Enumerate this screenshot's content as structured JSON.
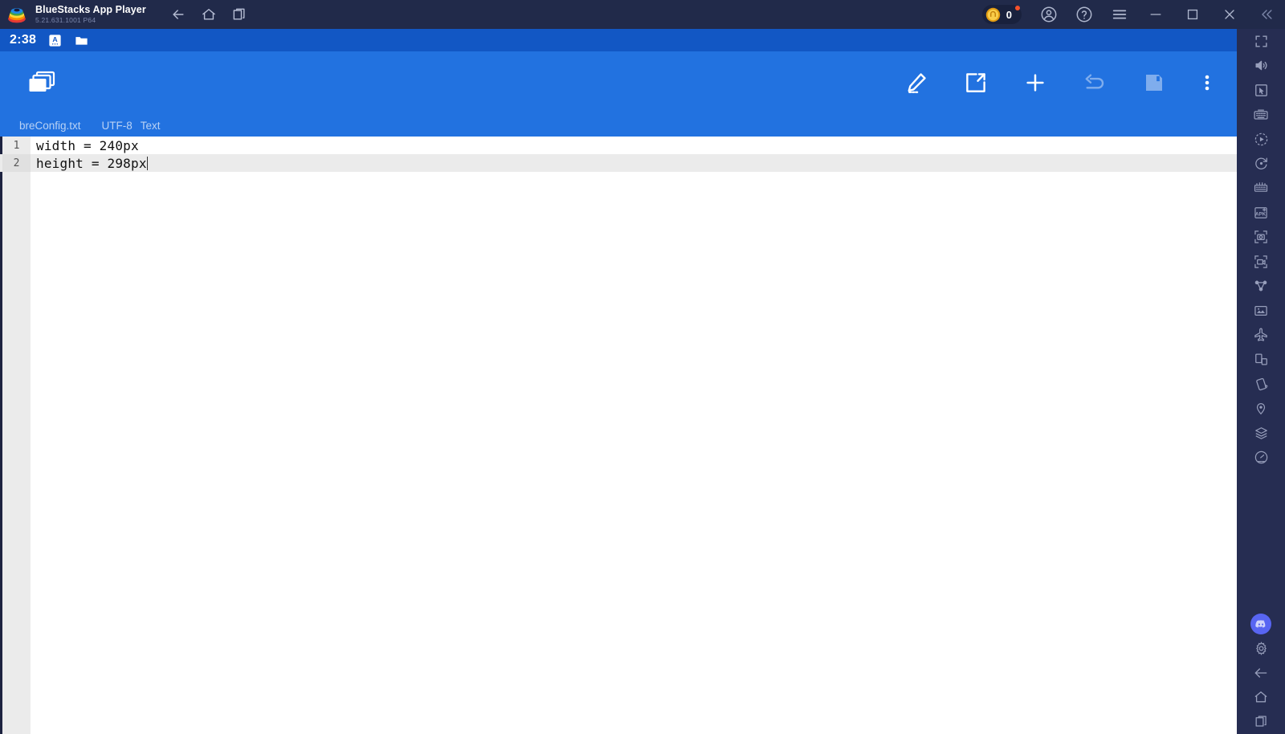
{
  "window": {
    "app_title": "BlueStacks App Player",
    "app_version": "5.21.631.1001 P64",
    "logo_icon": "bluestacks-logo-icon",
    "nav": [
      {
        "name": "back",
        "label": "Back",
        "icon": "arrow-left-icon"
      },
      {
        "name": "home",
        "label": "Home",
        "icon": "home-icon"
      },
      {
        "name": "recents",
        "label": "Recent apps",
        "icon": "recent-apps-icon"
      }
    ],
    "coin_badge": {
      "value": "0",
      "icon": "coin-icon",
      "has_notification_dot": true
    },
    "right_controls": [
      {
        "name": "account",
        "label": "Account",
        "icon": "account-circle-icon"
      },
      {
        "name": "help",
        "label": "Help",
        "icon": "help-circle-icon"
      },
      {
        "name": "menu",
        "label": "Menu",
        "icon": "hamburger-menu-icon"
      },
      {
        "name": "minimize",
        "label": "Minimize",
        "icon": "minimize-icon"
      },
      {
        "name": "maximize",
        "label": "Maximize",
        "icon": "maximize-icon"
      },
      {
        "name": "close",
        "label": "Close",
        "icon": "close-icon"
      },
      {
        "name": "collapse-sidebar",
        "label": "Collapse",
        "icon": "chevron-double-left-icon"
      }
    ],
    "colors": {
      "titlebar_bg": "#212a4a",
      "statusbar_bg": "#1257c4",
      "appbar_bg": "#2272e0",
      "sidebar_bg": "#262d52",
      "accent_blue": "#2272e0",
      "coin_gold": "#f2b32c",
      "notify_red": "#f5512a",
      "discord_purple": "#5865f2"
    }
  },
  "android": {
    "statusbar": {
      "clock": "2:38",
      "icons": [
        {
          "name": "input-method",
          "icon": "keyboard-ime-icon"
        },
        {
          "name": "file-manager",
          "icon": "folder-icon"
        }
      ]
    },
    "appbar": {
      "left_icon": "stacked-windows-icon",
      "actions": [
        {
          "name": "edit",
          "label": "Edit",
          "icon": "pencil-edit-icon",
          "enabled": true
        },
        {
          "name": "share",
          "label": "Share",
          "icon": "share-external-icon",
          "enabled": true
        },
        {
          "name": "new",
          "label": "New",
          "icon": "plus-icon",
          "enabled": true
        },
        {
          "name": "undo",
          "label": "Undo",
          "icon": "undo-arrow-icon",
          "enabled": false
        },
        {
          "name": "save",
          "label": "Save",
          "icon": "floppy-save-icon",
          "enabled": false
        },
        {
          "name": "overflow",
          "label": "More options",
          "icon": "more-vertical-icon",
          "enabled": true
        }
      ]
    },
    "filebar": {
      "filename": "breConfig.txt",
      "encoding": "UTF-8",
      "filetype": "Text"
    },
    "editor": {
      "lines": [
        {
          "number": "1",
          "text": "width = 240px",
          "current": false
        },
        {
          "number": "2",
          "text": "height = 298px",
          "current": true
        }
      ],
      "cursor_line": 2
    }
  },
  "sidebar": {
    "items": [
      {
        "name": "fullscreen",
        "label": "Full screen",
        "icon": "fullscreen-icon"
      },
      {
        "name": "volume",
        "label": "Volume",
        "icon": "speaker-volume-icon"
      },
      {
        "name": "pointer",
        "label": "Cursor",
        "icon": "cursor-pointer-icon"
      },
      {
        "name": "keyboard-controls",
        "label": "Game controls",
        "icon": "keyboard-icon"
      },
      {
        "name": "macro",
        "label": "Macro recorder",
        "icon": "macro-play-icon"
      },
      {
        "name": "rotate",
        "label": "Rotate",
        "icon": "rotate-icon"
      },
      {
        "name": "multi-instance",
        "label": "Multi-instance",
        "icon": "instance-manager-icon"
      },
      {
        "name": "install-apk",
        "label": "Install APK",
        "icon": "apk-install-icon"
      },
      {
        "name": "screenshot",
        "label": "Screenshot",
        "icon": "screenshot-camera-icon"
      },
      {
        "name": "record",
        "label": "Record screen",
        "icon": "record-video-icon"
      },
      {
        "name": "sync",
        "label": "Sync operations",
        "icon": "sync-instances-icon"
      },
      {
        "name": "media-manager",
        "label": "Media manager",
        "icon": "media-gallery-icon"
      },
      {
        "name": "eco-mode",
        "label": "Eco mode",
        "icon": "airplane-icon"
      },
      {
        "name": "multi-window",
        "label": "Multi window",
        "icon": "multi-window-icon"
      },
      {
        "name": "shake",
        "label": "Shake",
        "icon": "shake-device-icon"
      },
      {
        "name": "location",
        "label": "Location",
        "icon": "location-pin-icon"
      },
      {
        "name": "layers",
        "label": "Layers",
        "icon": "layers-stack-icon"
      },
      {
        "name": "performance",
        "label": "Performance",
        "icon": "speedometer-icon"
      }
    ],
    "bottom_items": [
      {
        "name": "discord",
        "label": "Discord",
        "icon": "discord-icon"
      },
      {
        "name": "settings",
        "label": "Settings",
        "icon": "gear-icon"
      },
      {
        "name": "back",
        "label": "Back",
        "icon": "arrow-left-icon"
      },
      {
        "name": "home",
        "label": "Home",
        "icon": "home-icon"
      },
      {
        "name": "recents",
        "label": "Recent apps",
        "icon": "recent-apps-icon"
      }
    ]
  }
}
